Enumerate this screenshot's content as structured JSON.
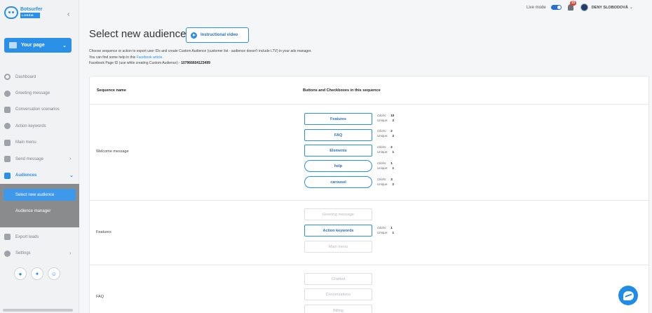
{
  "brand": {
    "name": "Botsurfer",
    "tagline": "LOREM"
  },
  "sidebar": {
    "page_button": "Your page",
    "items": [
      {
        "label": "Dashboard"
      },
      {
        "label": "Greeting message"
      },
      {
        "label": "Conversation scenarios"
      },
      {
        "label": "Action keywords"
      },
      {
        "label": "Main menu"
      },
      {
        "label": "Send message"
      },
      {
        "label": "Audiences"
      }
    ],
    "sub_items": [
      {
        "label": "Select new audience"
      },
      {
        "label": "Audience manager"
      }
    ],
    "bottom_items": [
      {
        "label": "Export leads"
      },
      {
        "label": "Settings"
      }
    ]
  },
  "topbar": {
    "live_mode": "Live mode",
    "notifications": "15",
    "user": "DENY SLOBODOVÁ"
  },
  "main": {
    "title": "Select new audience",
    "video_button": "Instructional video",
    "desc_line1": "Choose sequence or action to export user IDs and create Custom Audience (customer list - audience doesn't include LTV) in your ads manager.",
    "desc_line2_pre": "You can find some help in this ",
    "desc_line2_link": "Facebook article",
    "desc_line2_post": ".",
    "desc_line3_pre": "Facebook Page ID (use while creating Custom Audience) - ",
    "page_id": "107966604123499"
  },
  "table": {
    "col_name": "Sequence name",
    "col_buttons": "Buttons and Checkboxes in this sequence",
    "clicks_label": "Clicks:",
    "unique_label": "Unique:",
    "rows": [
      {
        "name": "Welcome message",
        "buttons": [
          {
            "label": "Features",
            "clicks": "10",
            "unique": "2"
          },
          {
            "label": "FAQ",
            "clicks": "2",
            "unique": "2"
          },
          {
            "label": "Elements",
            "clicks": "2",
            "unique": "1"
          },
          {
            "label": "help",
            "clicks": "1",
            "unique": "1"
          },
          {
            "label": "carousel",
            "clicks": "3",
            "unique": "2"
          }
        ]
      },
      {
        "name": "Features",
        "buttons": [
          {
            "label": "Greeting message"
          },
          {
            "label": "Action keywords",
            "clicks": "1",
            "unique": "1"
          },
          {
            "label": "Main menu"
          }
        ]
      },
      {
        "name": "FAQ",
        "buttons": [
          {
            "label": "Chatbot"
          },
          {
            "label": "Conversations"
          },
          {
            "label": "Billing"
          }
        ]
      }
    ]
  }
}
